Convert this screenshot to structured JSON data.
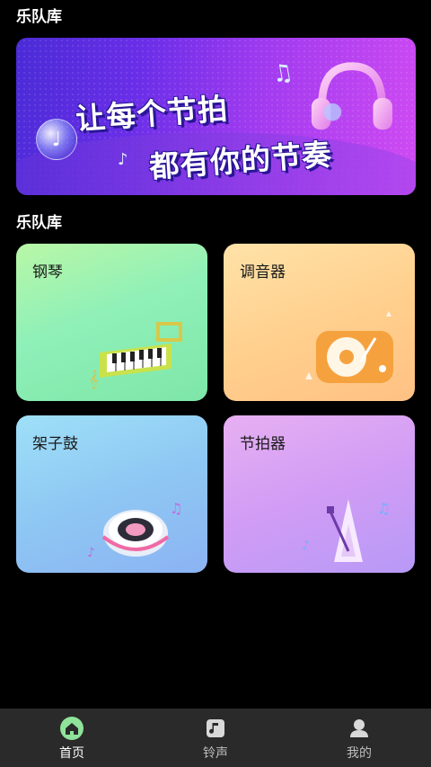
{
  "header": {
    "title": "乐队库"
  },
  "banner": {
    "line1": "让每个节拍",
    "line2": "都有你的节奏"
  },
  "section": {
    "title": "乐队库"
  },
  "cards": [
    {
      "label": "钢琴",
      "icon": "piano-icon"
    },
    {
      "label": "调音器",
      "icon": "turntable-icon"
    },
    {
      "label": "架子鼓",
      "icon": "drum-icon"
    },
    {
      "label": "节拍器",
      "icon": "metronome-icon"
    }
  ],
  "tabbar": {
    "items": [
      {
        "label": "首页",
        "icon": "home-icon",
        "active": true
      },
      {
        "label": "铃声",
        "icon": "music-note-icon",
        "active": false
      },
      {
        "label": "我的",
        "icon": "user-icon",
        "active": false
      }
    ]
  },
  "colors": {
    "background": "#000000",
    "tabbar": "#2a2a2a",
    "active_icon": "#8fe39a"
  }
}
